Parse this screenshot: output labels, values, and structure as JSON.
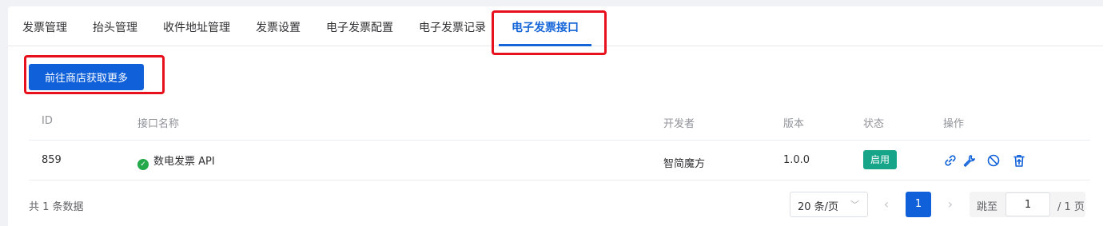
{
  "tabs": [
    {
      "label": "发票管理"
    },
    {
      "label": "抬头管理"
    },
    {
      "label": "收件地址管理"
    },
    {
      "label": "发票设置"
    },
    {
      "label": "电子发票配置"
    },
    {
      "label": "电子发票记录"
    },
    {
      "label": "电子发票接口",
      "active": true
    }
  ],
  "toolbar": {
    "shop_button": "前往商店获取更多"
  },
  "table": {
    "headers": [
      "ID",
      "接口名称",
      "开发者",
      "版本",
      "状态",
      "操作"
    ],
    "rows": [
      {
        "id": "859",
        "name": "数电发票 API",
        "developer": "智简魔方",
        "version": "1.0.0",
        "status": "启用",
        "status_color": "#17a58a",
        "actions": [
          "link-icon",
          "wrench-icon",
          "disable-icon",
          "delete-icon"
        ]
      }
    ]
  },
  "pagination": {
    "total_text": "共 1 条数据",
    "page_size": "20 条/页",
    "current_page": "1",
    "jump_label": "跳至",
    "jump_value": "1",
    "total_pages_text": "/ 1 页"
  },
  "colors": {
    "primary": "#1061d9",
    "active_tab": "#1565d8",
    "highlight": "#e8101d",
    "success": "#23a94a"
  }
}
